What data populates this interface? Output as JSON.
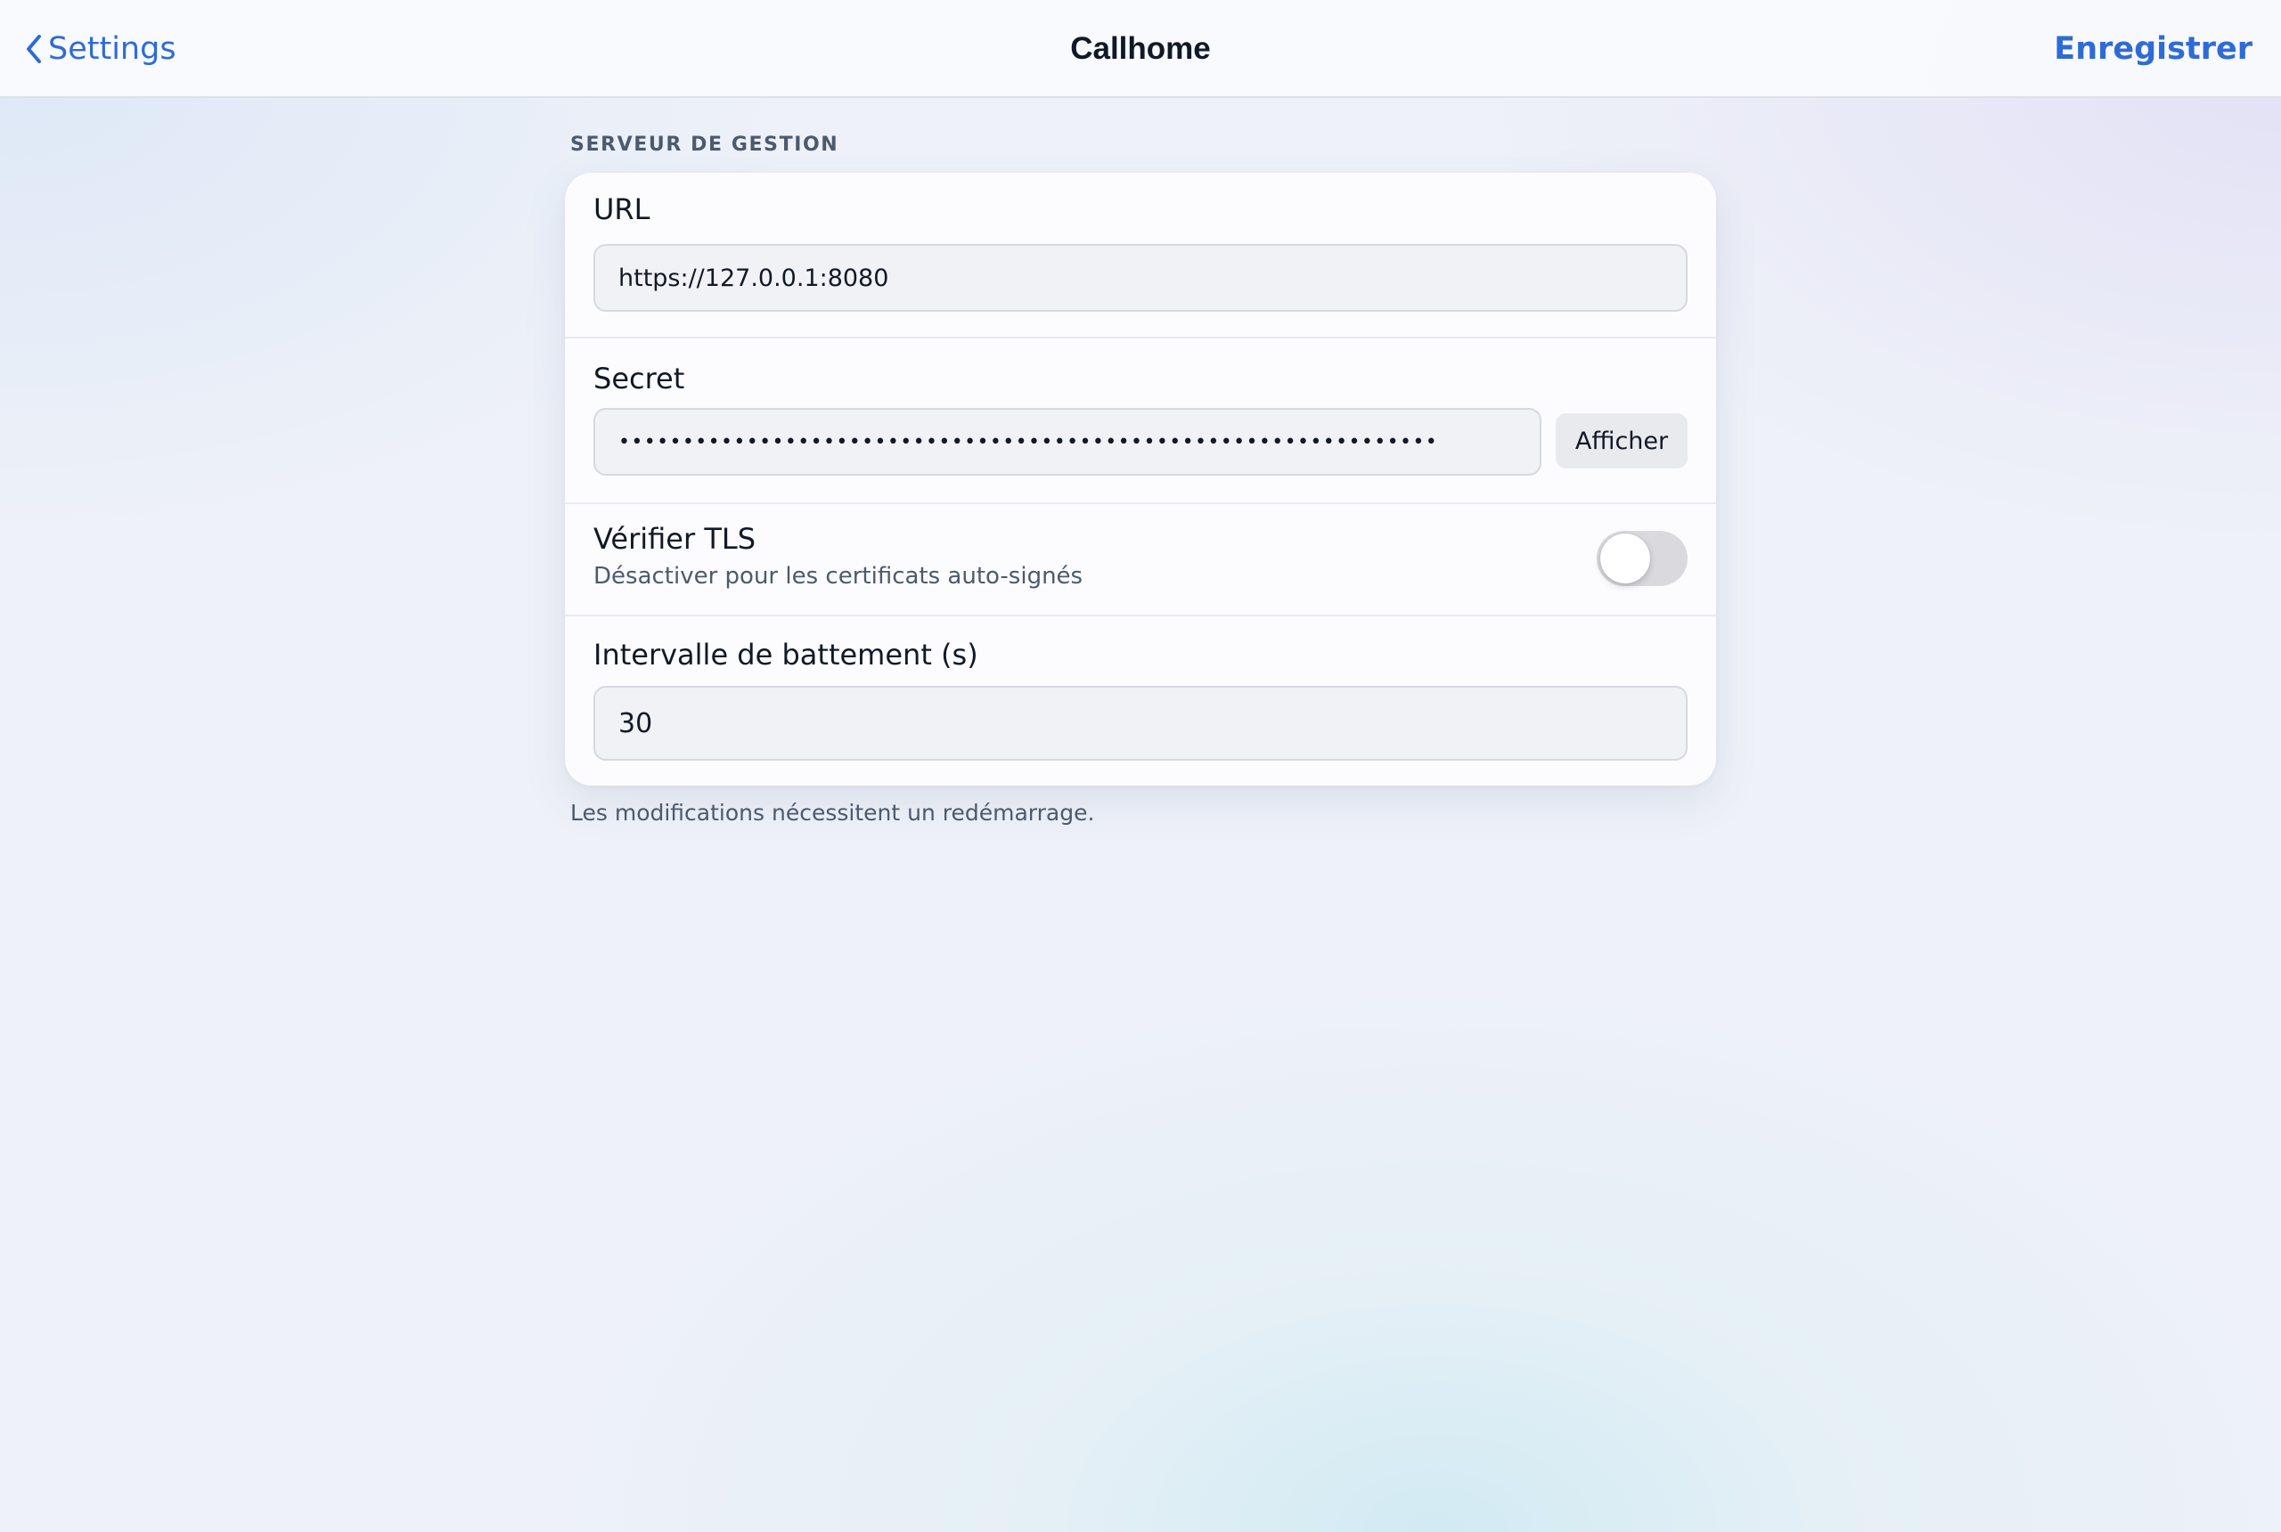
{
  "nav": {
    "back_label": "Settings",
    "title": "Callhome",
    "save_label": "Enregistrer"
  },
  "section": {
    "header": "SERVEUR DE GESTION",
    "footer": "Les modifications nécessitent un redémarrage."
  },
  "fields": {
    "url": {
      "label": "URL",
      "value": "https://127.0.0.1:8080"
    },
    "secret": {
      "label": "Secret",
      "masked_value": "••••••••••••••••••••••••••••••••••••••••••••••••••••••••••••••••",
      "show_button": "Afficher"
    },
    "tls": {
      "label": "Vérifier TLS",
      "description": "Désactiver pour les certificats auto-signés",
      "enabled": false
    },
    "interval": {
      "label": "Intervalle de battement (s)",
      "value": "30"
    }
  },
  "colors": {
    "accent": "#2f6bd6",
    "text_primary": "#111827",
    "text_secondary": "#4b5a6e",
    "toggle_off": "#d9d9de"
  },
  "icons": {
    "back": "chevron-left-icon"
  }
}
